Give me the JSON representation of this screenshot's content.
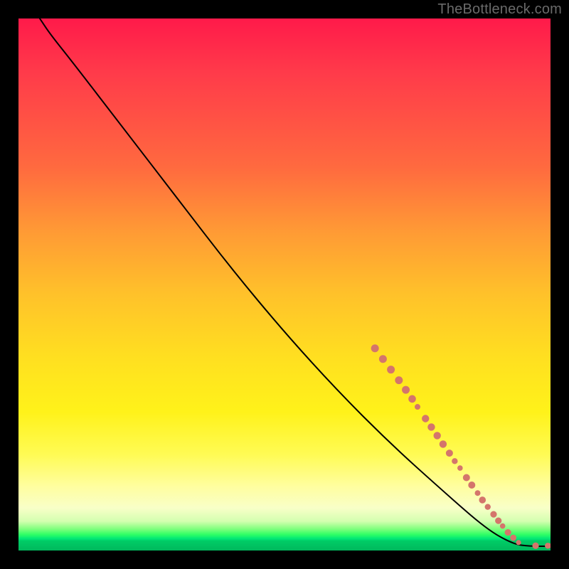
{
  "watermark": "TheBottleneck.com",
  "chart_data": {
    "type": "line",
    "title": "",
    "xlabel": "",
    "ylabel": "",
    "xlim": [
      0,
      100
    ],
    "ylim": [
      0,
      100
    ],
    "grid": false,
    "legend": false,
    "curve": {
      "description": "Smooth monotone-decreasing curve from top-left to bottom-right, flattening at the bottom",
      "points": [
        {
          "x": 4,
          "y": 100
        },
        {
          "x": 6,
          "y": 97
        },
        {
          "x": 10,
          "y": 92
        },
        {
          "x": 20,
          "y": 79
        },
        {
          "x": 30,
          "y": 66
        },
        {
          "x": 40,
          "y": 53
        },
        {
          "x": 50,
          "y": 41
        },
        {
          "x": 60,
          "y": 30
        },
        {
          "x": 70,
          "y": 20
        },
        {
          "x": 80,
          "y": 11
        },
        {
          "x": 88,
          "y": 4
        },
        {
          "x": 93,
          "y": 1.2
        },
        {
          "x": 96,
          "y": 0.8
        },
        {
          "x": 100,
          "y": 0.8
        }
      ]
    },
    "markers": {
      "color": "#d4756b",
      "radius_range": [
        3.5,
        6.5
      ],
      "points": [
        {
          "x": 67,
          "y": 38,
          "r": 5.5
        },
        {
          "x": 68.5,
          "y": 36,
          "r": 5.5
        },
        {
          "x": 70,
          "y": 34,
          "r": 5.5
        },
        {
          "x": 71.5,
          "y": 32,
          "r": 5.5
        },
        {
          "x": 72.8,
          "y": 30.2,
          "r": 5.5
        },
        {
          "x": 74,
          "y": 28.5,
          "r": 5.3
        },
        {
          "x": 75,
          "y": 27,
          "r": 4.0
        },
        {
          "x": 76.5,
          "y": 24.8,
          "r": 5.2
        },
        {
          "x": 77.6,
          "y": 23.2,
          "r": 5.2
        },
        {
          "x": 78.7,
          "y": 21.6,
          "r": 5.2
        },
        {
          "x": 79.8,
          "y": 20.0,
          "r": 5.2
        },
        {
          "x": 81,
          "y": 18.3,
          "r": 5.0
        },
        {
          "x": 82,
          "y": 16.8,
          "r": 4.2
        },
        {
          "x": 83,
          "y": 15.5,
          "r": 3.8
        },
        {
          "x": 84.2,
          "y": 13.7,
          "r": 5.0
        },
        {
          "x": 85.2,
          "y": 12.3,
          "r": 5.0
        },
        {
          "x": 86.3,
          "y": 10.8,
          "r": 4.0
        },
        {
          "x": 87.2,
          "y": 9.5,
          "r": 4.8
        },
        {
          "x": 88.2,
          "y": 8.2,
          "r": 4.2
        },
        {
          "x": 89.3,
          "y": 6.8,
          "r": 4.6
        },
        {
          "x": 90.2,
          "y": 5.6,
          "r": 4.6
        },
        {
          "x": 91.0,
          "y": 4.6,
          "r": 3.8
        },
        {
          "x": 92.0,
          "y": 3.4,
          "r": 4.6
        },
        {
          "x": 93.0,
          "y": 2.4,
          "r": 4.4
        },
        {
          "x": 94.0,
          "y": 1.5,
          "r": 3.6
        },
        {
          "x": 97.2,
          "y": 0.9,
          "r": 4.6
        },
        {
          "x": 99.5,
          "y": 0.9,
          "r": 4.2
        },
        {
          "x": 100.3,
          "y": 0.9,
          "r": 4.2
        }
      ]
    }
  }
}
